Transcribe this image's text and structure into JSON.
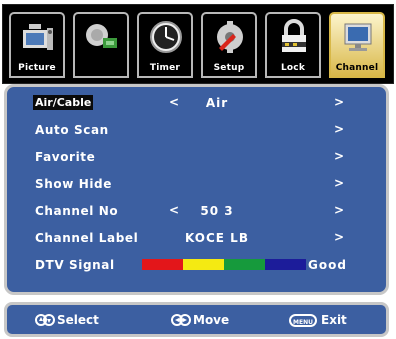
{
  "tabs": [
    {
      "label": "Picture",
      "icon": "picture-icon",
      "active": false
    },
    {
      "label": "",
      "icon": "sound-icon",
      "active": false
    },
    {
      "label": "Timer",
      "icon": "clock-icon",
      "active": false
    },
    {
      "label": "Setup",
      "icon": "setup-icon",
      "active": false
    },
    {
      "label": "Lock",
      "icon": "lock-icon",
      "active": false
    },
    {
      "label": "Channel",
      "icon": "monitor-icon",
      "active": true
    }
  ],
  "menu": {
    "rows": [
      {
        "label": "Air/Cable",
        "value": "Air",
        "left_arrow": "<",
        "right_arrow": ">",
        "selected": true
      },
      {
        "label": "Auto Scan",
        "value": "",
        "right_arrow": ">"
      },
      {
        "label": "Favorite",
        "value": "",
        "right_arrow": ">"
      },
      {
        "label": "Show Hide",
        "value": "",
        "right_arrow": ">"
      },
      {
        "label": "Channel No",
        "value": "50 3",
        "left_arrow": "<",
        "right_arrow": ">"
      },
      {
        "label": "Channel Label",
        "value": "KOCE LB",
        "right_arrow": ">"
      },
      {
        "label": "DTV Signal",
        "value": "Good"
      }
    ],
    "signal_colors": [
      "#e3161a",
      "#f4ea12",
      "#169a3c",
      "#1c1c9a"
    ]
  },
  "footer": {
    "select_label": "Select",
    "move_label": "Move",
    "menu_key": "MENU",
    "exit_label": "Exit"
  },
  "colors": {
    "panel_bg": "#3c5fa1",
    "panel_border": "#c7c7c7",
    "active_tab": "#d9b84a"
  }
}
